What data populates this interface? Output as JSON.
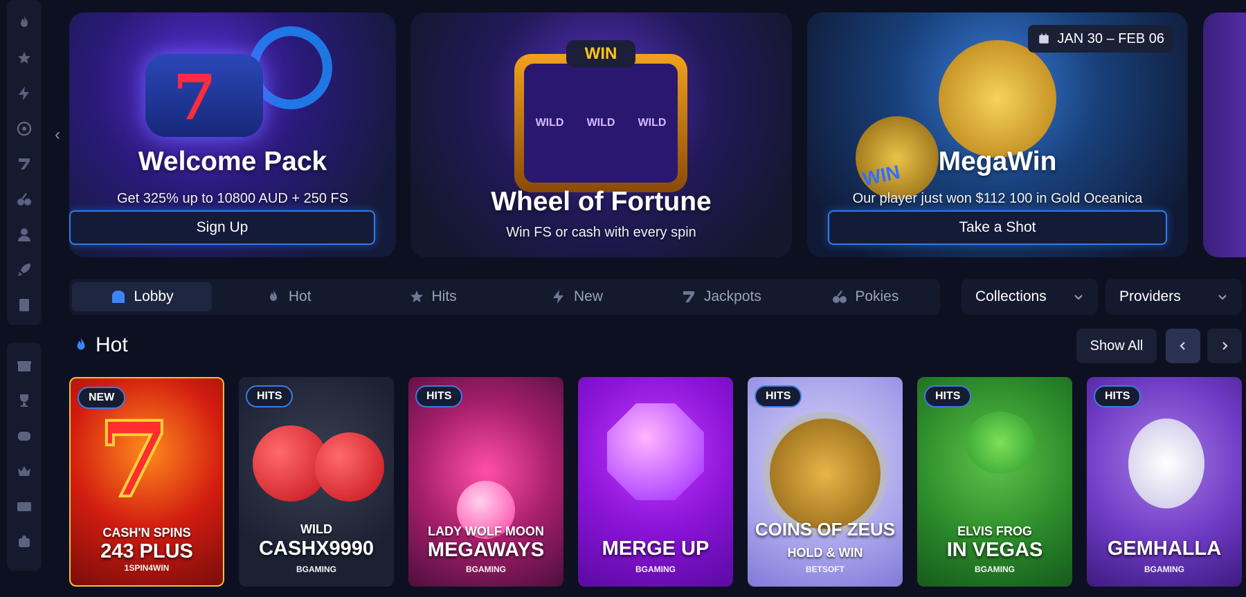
{
  "sidebar": {
    "group1": [
      {
        "icon": "flame-icon"
      },
      {
        "icon": "stars-icon"
      },
      {
        "icon": "lightning-icon"
      },
      {
        "icon": "target-icon"
      },
      {
        "icon": "seven-icon"
      },
      {
        "icon": "cherries-icon"
      },
      {
        "icon": "dealer-icon"
      },
      {
        "icon": "rocket-icon"
      },
      {
        "icon": "cards-icon"
      }
    ],
    "group2": [
      {
        "icon": "gift-icon"
      },
      {
        "icon": "trophy-icon"
      },
      {
        "icon": "slot-machine-icon"
      },
      {
        "icon": "crown-icon"
      },
      {
        "icon": "wallet-card-icon"
      },
      {
        "icon": "support-icon"
      }
    ]
  },
  "banners": [
    {
      "title": "Welcome Pack",
      "subtitle": "Get 325% up to 10800 AUD + 250 FS",
      "cta": "Sign Up"
    },
    {
      "title": "Wheel of Fortune",
      "subtitle": "Win FS or cash with every spin",
      "art_label": "WIN",
      "reel_label": "WILD"
    },
    {
      "title": "MegaWin",
      "subtitle": "Our player just won $112 100 in Gold Oceanica",
      "cta": "Take a Shot",
      "date": "JAN 30 – FEB 06",
      "art_label": "WIN"
    }
  ],
  "tabs": [
    {
      "label": "Lobby",
      "icon": "lobby-icon",
      "active": true
    },
    {
      "label": "Hot",
      "icon": "flame-icon"
    },
    {
      "label": "Hits",
      "icon": "stars-icon"
    },
    {
      "label": "New",
      "icon": "lightning-icon"
    },
    {
      "label": "Jackpots",
      "icon": "seven-icon"
    },
    {
      "label": "Pokies",
      "icon": "cherries-icon"
    }
  ],
  "dropdowns": {
    "collections": "Collections",
    "providers": "Providers"
  },
  "section": {
    "title": "Hot",
    "show_all": "Show All"
  },
  "games": [
    {
      "badge": "NEW",
      "line1": "CASH'N SPINS",
      "line2": "243 PLUS",
      "provider": "1SPIN4WIN"
    },
    {
      "badge": "HITS",
      "line1": "WILD",
      "line2": "CASHX9990",
      "provider": "BGAMING"
    },
    {
      "badge": "HITS",
      "line1": "LADY WOLF MOON",
      "line2": "MEGAWAYS",
      "provider": "BGAMING"
    },
    {
      "badge": "",
      "line1": "",
      "line2": "MERGE UP",
      "provider": "BGAMING"
    },
    {
      "badge": "HITS",
      "line1": "COINS OF ZEUS",
      "line2": "HOLD & WIN",
      "provider": "BETSOFT"
    },
    {
      "badge": "HITS",
      "line1": "ELVIS FROG",
      "line2": "IN VEGAS",
      "provider": "BGAMING"
    },
    {
      "badge": "HITS",
      "line1": "",
      "line2": "GEMHALLA",
      "provider": "BGAMING"
    }
  ],
  "colors": {
    "accent": "#2c7ef0",
    "background": "#0c1020",
    "panel": "#141a2e"
  }
}
